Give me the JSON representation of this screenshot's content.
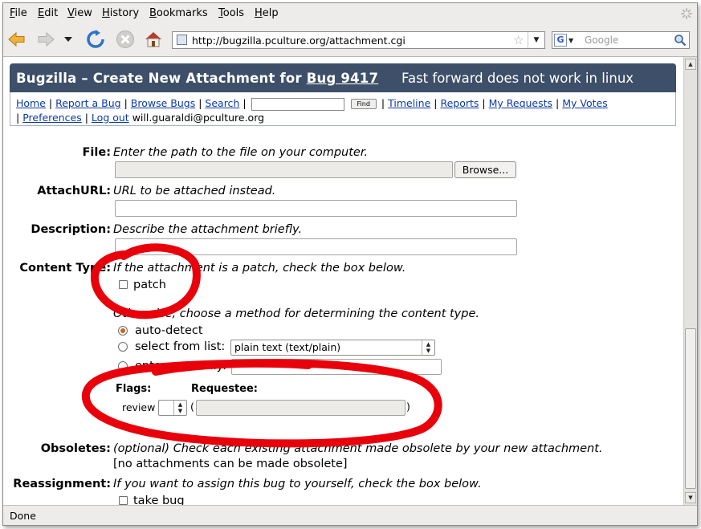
{
  "menu": {
    "items": [
      "File",
      "Edit",
      "View",
      "History",
      "Bookmarks",
      "Tools",
      "Help"
    ]
  },
  "toolbar": {
    "url": "http://bugzilla.pculture.org/attachment.cgi",
    "search_placeholder": "Google",
    "search_engine_letter": "G"
  },
  "header": {
    "title_prefix": "Bugzilla – Create New Attachment for",
    "bug_link": "Bug 9417",
    "summary": "Fast forward does not work in linux"
  },
  "nav_links": {
    "home": "Home",
    "report": "Report a Bug",
    "browse": "Browse Bugs",
    "search": "Search",
    "find_button": "Find",
    "timeline": "Timeline",
    "reports": "Reports",
    "my_requests": "My Requests",
    "my_votes": "My Votes",
    "preferences": "Preferences",
    "logout": "Log out",
    "user_email": "will.guaraldi@pculture.org",
    "separator": "|"
  },
  "form": {
    "file": {
      "label": "File:",
      "hint": "Enter the path to the file on your computer.",
      "browse_button": "Browse..."
    },
    "attachurl": {
      "label": "AttachURL:",
      "hint": "URL to be attached instead."
    },
    "description": {
      "label": "Description:",
      "hint": "Describe the attachment briefly."
    },
    "content_type": {
      "label": "Content Type:",
      "hint_patch": "If the attachment is a patch, check the box below.",
      "patch_label": "patch",
      "patch_checked": false,
      "hint_otherwise": "Otherwise, choose a method for determining the content type.",
      "auto_detect": "auto-detect",
      "select_from_list": "select from list:",
      "selected_type": "plain text (text/plain)",
      "enter_manually": "enter manually:",
      "selected_method": "auto-detect"
    },
    "flags": {
      "flags_header": "Flags:",
      "requestee_header": "Requestee:",
      "review_label": "review",
      "open_paren": "(",
      "close_paren": ")"
    },
    "obsoletes": {
      "label": "Obsoletes:",
      "hint": "(optional) Check each existing attachment made obsolete by your new attachment.",
      "none_text": "[no attachments can be made obsolete]"
    },
    "reassignment": {
      "label": "Reassignment:",
      "hint": "If you want to assign this bug to yourself, check the box below.",
      "take_bug": "take bug"
    }
  },
  "status": {
    "text": "Done"
  },
  "colors": {
    "header_bg": "#3d4f69",
    "link": "#0b3aaa",
    "annotation": "#e8000b",
    "radio_selected": "#d1621a"
  }
}
